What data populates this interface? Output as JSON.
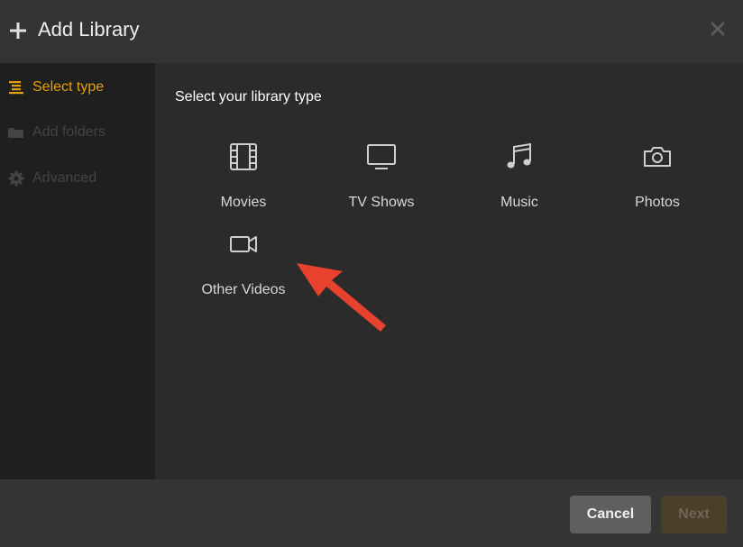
{
  "dialog": {
    "title": "Add Library",
    "close_icon": "close-icon"
  },
  "sidebar": {
    "items": [
      {
        "label": "Select type",
        "icon": "list-icon",
        "state": "active"
      },
      {
        "label": "Add folders",
        "icon": "folder-icon",
        "state": "disabled"
      },
      {
        "label": "Advanced",
        "icon": "gear-icon",
        "state": "disabled"
      }
    ]
  },
  "main": {
    "heading": "Select your library type",
    "types": [
      {
        "label": "Movies",
        "icon": "film-icon"
      },
      {
        "label": "TV Shows",
        "icon": "tv-icon"
      },
      {
        "label": "Music",
        "icon": "music-note-icon"
      },
      {
        "label": "Photos",
        "icon": "camera-icon"
      },
      {
        "label": "Other Videos",
        "icon": "video-camera-icon"
      }
    ]
  },
  "footer": {
    "cancel_label": "Cancel",
    "next_label": "Next"
  },
  "colors": {
    "accent": "#e5a00d",
    "annotation_arrow": "#e8412c"
  }
}
